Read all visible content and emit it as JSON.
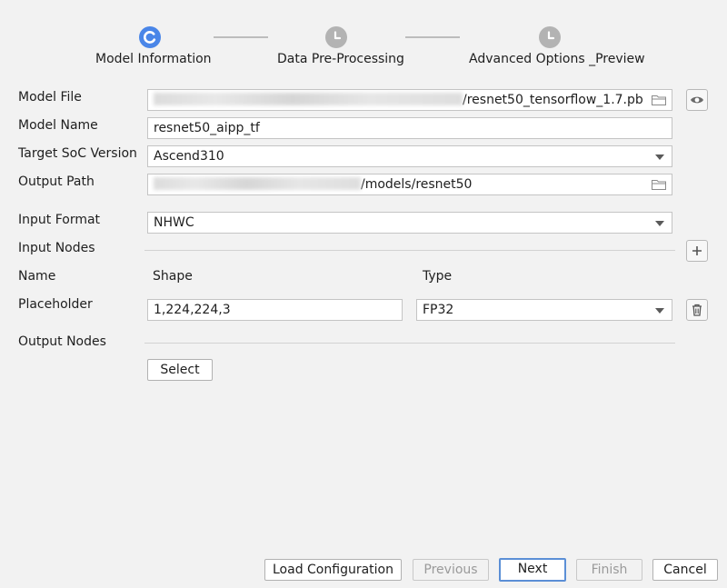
{
  "stepper": {
    "steps": [
      {
        "label": "Model Information",
        "state": "active"
      },
      {
        "label": "Data Pre-Processing",
        "state": "pending"
      },
      {
        "label": "Advanced Options _Preview",
        "state": "pending"
      }
    ],
    "active_color": "#4a86e8",
    "pending_color": "#b3b3b3"
  },
  "form": {
    "model_file": {
      "label": "Model File",
      "value": "/resnet50_tensorflow_1.7.pb"
    },
    "model_name": {
      "label": "Model Name",
      "value": "resnet50_aipp_tf"
    },
    "target_soc": {
      "label": "Target SoC Version",
      "value": "Ascend310"
    },
    "output_path": {
      "label": "Output Path",
      "value": "/models/resnet50"
    },
    "input_format": {
      "label": "Input Format",
      "value": "NHWC"
    },
    "input_nodes": {
      "label": "Input Nodes",
      "col_name": "Name",
      "col_shape": "Shape",
      "col_type": "Type",
      "rows": [
        {
          "name": "Placeholder",
          "shape": "1,224,224,3",
          "type": "FP32"
        }
      ]
    },
    "output_nodes": {
      "label": "Output Nodes",
      "select_label": "Select"
    }
  },
  "footer": {
    "load_configuration": "Load Configuration",
    "previous": "Previous",
    "next": "Next",
    "finish": "Finish",
    "cancel": "Cancel"
  },
  "icons": {
    "view": "eye-icon",
    "browse": "folder-icon",
    "add": "plus-icon",
    "delete": "trash-icon",
    "dropdown": "chevron-down-icon"
  }
}
